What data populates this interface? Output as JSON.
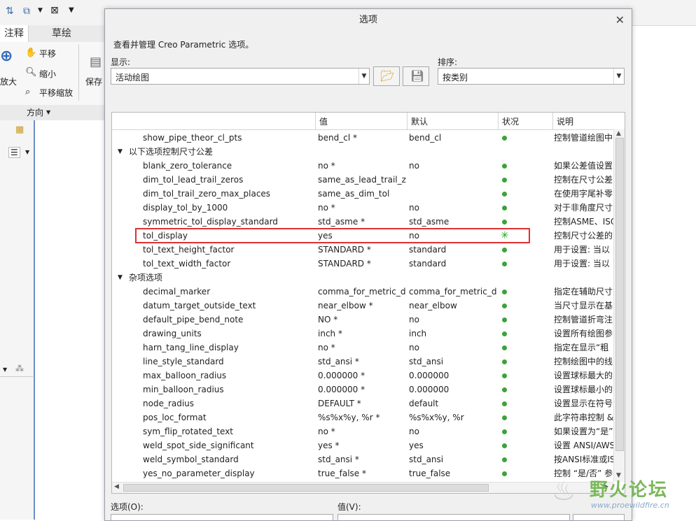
{
  "bg": {
    "tabs": [
      "注释",
      "草绘"
    ],
    "ribbon": {
      "pan": "平移",
      "zoom_in": "放大",
      "zoom_out": "缩小",
      "pan_zoom": "平移缩放",
      "save": "保存"
    },
    "group_label": "方向"
  },
  "dialog": {
    "title": "选项",
    "description": "查看并管理 Creo Parametric 选项。",
    "show_label": "显示:",
    "show_value": "活动绘图",
    "sort_label": "排序:",
    "sort_value": "按类别",
    "columns": [
      "值",
      "默认",
      "状况",
      "说明"
    ],
    "rows": [
      {
        "kind": "opt",
        "name": "show_pipe_theor_cl_pts",
        "value": "bend_cl *",
        "default": "bend_cl",
        "status": "dot",
        "desc": "控制管道绘图中"
      },
      {
        "kind": "cat",
        "name": "以下选项控制尺寸公差"
      },
      {
        "kind": "opt",
        "name": "blank_zero_tolerance",
        "value": "no *",
        "default": "no",
        "status": "dot",
        "desc": "如果公差值设置"
      },
      {
        "kind": "opt",
        "name": "dim_tol_lead_trail_zeros",
        "value": "same_as_lead_trail_z...",
        "default": "",
        "status": "dot",
        "desc": "控制在尺寸公差"
      },
      {
        "kind": "opt",
        "name": "dim_tol_trail_zero_max_places",
        "value": "same_as_dim_tol",
        "default": "",
        "status": "dot",
        "desc": "在使用字尾补零"
      },
      {
        "kind": "opt",
        "name": "display_tol_by_1000",
        "value": "no *",
        "default": "no",
        "status": "dot",
        "desc": "对于非角度尺寸"
      },
      {
        "kind": "opt",
        "name": "symmetric_tol_display_standard",
        "value": "std_asme *",
        "default": "std_asme",
        "status": "dot",
        "desc": "控制ASME、ISO"
      },
      {
        "kind": "opt",
        "name": "tol_display",
        "value": "yes",
        "default": "no",
        "status": "star",
        "desc": "控制尺寸公差的"
      },
      {
        "kind": "opt",
        "name": "tol_text_height_factor",
        "value": "STANDARD *",
        "default": "standard",
        "status": "dot",
        "desc": "用于设置: 当以"
      },
      {
        "kind": "opt",
        "name": "tol_text_width_factor",
        "value": "STANDARD *",
        "default": "standard",
        "status": "dot",
        "desc": "用于设置: 当以"
      },
      {
        "kind": "cat",
        "name": "杂项选项"
      },
      {
        "kind": "opt",
        "name": "decimal_marker",
        "value": "comma_for_metric_d...",
        "default": "comma_for_metric_d...",
        "status": "dot",
        "desc": "指定在辅助尺寸"
      },
      {
        "kind": "opt",
        "name": "datum_target_outside_text",
        "value": "near_elbow *",
        "default": "near_elbow",
        "status": "dot",
        "desc": "当尺寸显示在基"
      },
      {
        "kind": "opt",
        "name": "default_pipe_bend_note",
        "value": "NO *",
        "default": "no",
        "status": "dot",
        "desc": "控制管道折弯注"
      },
      {
        "kind": "opt",
        "name": "drawing_units",
        "value": "inch *",
        "default": "inch",
        "status": "dot",
        "desc": "设置所有绘图参"
      },
      {
        "kind": "opt",
        "name": "harn_tang_line_display",
        "value": "no *",
        "default": "no",
        "status": "dot",
        "desc": "指定在显示“粗"
      },
      {
        "kind": "opt",
        "name": "line_style_standard",
        "value": "std_ansi *",
        "default": "std_ansi",
        "status": "dot",
        "desc": "控制绘图中的线"
      },
      {
        "kind": "opt",
        "name": "max_balloon_radius",
        "value": "0.000000 *",
        "default": "0.000000",
        "status": "dot",
        "desc": "设置球标最大的"
      },
      {
        "kind": "opt",
        "name": "min_balloon_radius",
        "value": "0.000000 *",
        "default": "0.000000",
        "status": "dot",
        "desc": "设置球标最小的"
      },
      {
        "kind": "opt",
        "name": "node_radius",
        "value": "DEFAULT *",
        "default": "default",
        "status": "dot",
        "desc": "设置显示在符号"
      },
      {
        "kind": "opt",
        "name": "pos_loc_format",
        "value": "%s%x%y, %r *",
        "default": "%s%x%y, %r",
        "status": "dot",
        "desc": "此字符串控制 &"
      },
      {
        "kind": "opt",
        "name": "sym_flip_rotated_text",
        "value": "no *",
        "default": "no",
        "status": "dot",
        "desc": "如果设置为“是”"
      },
      {
        "kind": "opt",
        "name": "weld_spot_side_significant",
        "value": "yes *",
        "default": "yes",
        "status": "dot",
        "desc": "设置 ANSI/AWS"
      },
      {
        "kind": "opt",
        "name": "weld_symbol_standard",
        "value": "std_ansi *",
        "default": "std_ansi",
        "status": "dot",
        "desc": "按ANSI标准或IS"
      },
      {
        "kind": "opt",
        "name": "yes_no_parameter_display",
        "value": "true_false *",
        "default": "true_false",
        "status": "dot",
        "desc": "控制 “是/否” 参"
      }
    ],
    "option_label": "选项(O):",
    "value_label": "值(V):"
  },
  "watermark": {
    "text": "野火论坛",
    "url": "www.proewildfire.cn"
  },
  "colors": {
    "status_dot": "#3aa33a",
    "highlight_box": "#e03030",
    "watermark": "#7ab85a"
  }
}
